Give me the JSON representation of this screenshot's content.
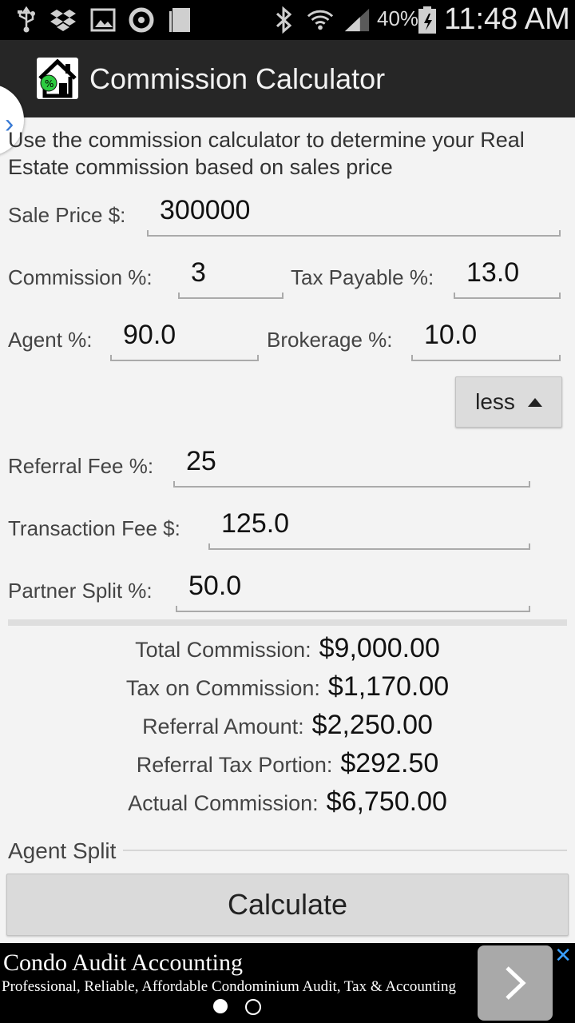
{
  "status_bar": {
    "icons": [
      "usb-icon",
      "dropbox-icon",
      "image-icon",
      "sync-icon",
      "sim-icon",
      "bluetooth-icon",
      "wifi-icon",
      "signal-icon",
      "battery-icon"
    ],
    "battery": "40%",
    "time": "11:48 AM"
  },
  "app": {
    "title": "Commission Calculator"
  },
  "intro": "Use the commission calculator to determine your Real Estate commission based on sales price",
  "form": {
    "sale_price_label": "Sale Price $:",
    "sale_price_value": "300000",
    "commission_label": "Commission %:",
    "commission_value": "3",
    "tax_label": "Tax Payable %:",
    "tax_value": "13.0",
    "agent_label": "Agent %:",
    "agent_value": "90.0",
    "brokerage_label": "Brokerage %:",
    "brokerage_value": "10.0",
    "toggle_label": "less",
    "referral_label": "Referral Fee %:",
    "referral_value": "25",
    "transaction_label": "Transaction Fee $:",
    "transaction_value": "125.0",
    "partner_label": "Partner Split %:",
    "partner_value": "50.0"
  },
  "results": [
    {
      "label": "Total Commission:",
      "value": "$9,000.00"
    },
    {
      "label": "Tax on Commission:",
      "value": "$1,170.00"
    },
    {
      "label": "Referral Amount:",
      "value": "$2,250.00"
    },
    {
      "label": "Referral Tax Portion:",
      "value": "$292.50"
    },
    {
      "label": "Actual Commission:",
      "value": "$6,750.00"
    }
  ],
  "agent_split_label": "Agent Split",
  "calculate_label": "Calculate",
  "ad": {
    "title": "Condo Audit Accounting",
    "description": "Professional, Reliable, Affordable Condominium Audit, Tax & Accounting"
  },
  "colors": {
    "accent": "#3a7bd5",
    "action_bar": "#262626",
    "status_bar": "#000000"
  }
}
